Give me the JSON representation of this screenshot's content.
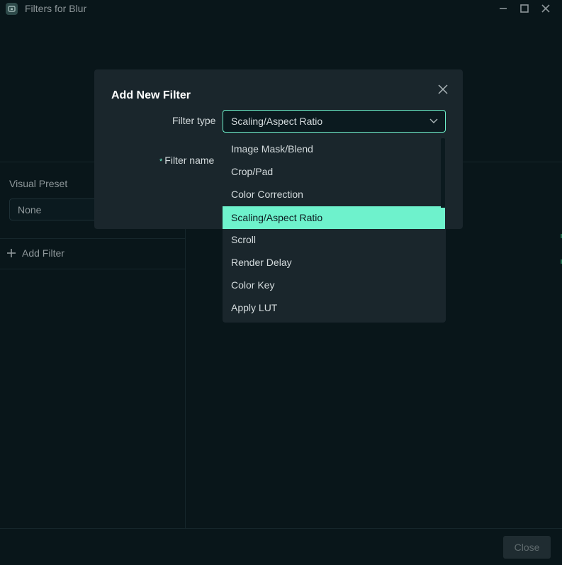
{
  "window": {
    "title": "Filters for Blur",
    "icons": [
      "app-icon",
      "minimize-icon",
      "maximize-icon",
      "close-icon"
    ]
  },
  "left_panel": {
    "visual_preset_label": "Visual Preset",
    "visual_preset_value": "None",
    "add_filter_label": "Add Filter"
  },
  "footer": {
    "close_label": "Close"
  },
  "modal": {
    "title": "Add New Filter",
    "filter_type_label": "Filter type",
    "filter_type_value": "Scaling/Aspect Ratio",
    "filter_name_required_mark": "*",
    "filter_name_label": "Filter name"
  },
  "dropdown": {
    "items": [
      {
        "label": "Image Mask/Blend"
      },
      {
        "label": "Crop/Pad"
      },
      {
        "label": "Color Correction"
      },
      {
        "label": "Scaling/Aspect Ratio",
        "selected": true
      },
      {
        "label": "Scroll"
      },
      {
        "label": "Render Delay"
      },
      {
        "label": "Color Key"
      },
      {
        "label": "Apply LUT"
      }
    ]
  },
  "colors": {
    "accent": "#6ef2cc",
    "background": "#09161a",
    "modal_bg": "#1a262c",
    "input_bg": "#0b1a1f"
  }
}
